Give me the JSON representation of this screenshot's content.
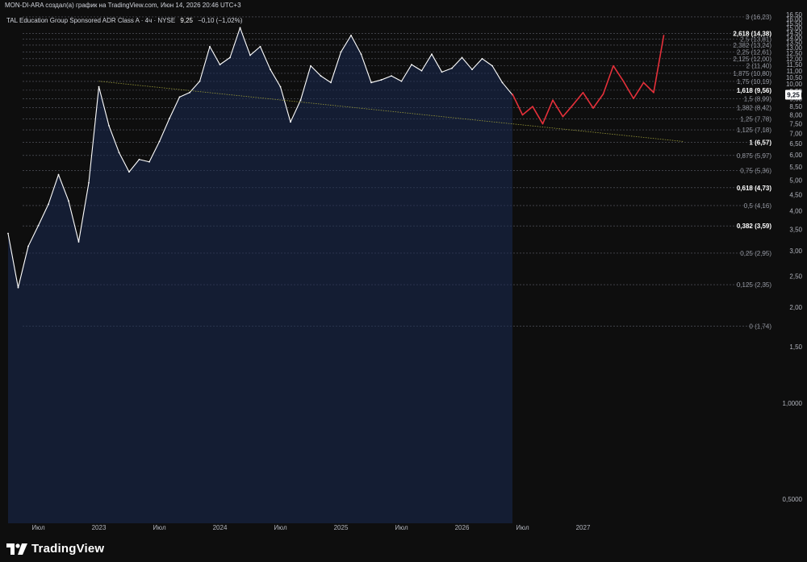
{
  "header": {
    "author_line": "MON-DI-ARA создал(а) график на TradingView.com, Июн 14, 2026 20:46 UTC+3"
  },
  "legend": {
    "symbol": "TAL Education Group Sponsored ADR Class A · 4ч · NYSE",
    "last": "9,25",
    "change": "−0,10 (−1,02%)"
  },
  "footer": {
    "brand": "TradingView"
  },
  "colors": {
    "background": "#0e0e0e",
    "price_line": "#ffffff",
    "area_fill": "#1a2a52",
    "projection": "#e5303a",
    "trendline": "#9a9a3a",
    "fib_lines": "#5d606b"
  },
  "chart_data": {
    "type": "area",
    "y_scale": "log",
    "ylim": [
      0.42,
      16.7
    ],
    "y_ticks": [
      "16,50",
      "16,00",
      "15,50",
      "15,00",
      "14,50",
      "14,00",
      "13,50",
      "13,00",
      "12,50",
      "12,00",
      "11,50",
      "11,00",
      "10,50",
      "10,00",
      "9,50",
      "9,00",
      "8,50",
      "8,00",
      "7,50",
      "7,00",
      "6,50",
      "6,00",
      "5,50",
      "5,00",
      "4,50",
      "4,00",
      "3,50",
      "3,00",
      "2,50",
      "2,00",
      "1,50",
      "1,0000",
      "0,5000"
    ],
    "x_ticks": [
      "Июл",
      "2023",
      "Июл",
      "2024",
      "Июл",
      "2025",
      "Июл",
      "2026",
      "Июл",
      "2027"
    ],
    "last_price_label": "9,25",
    "price_series": {
      "name": "",
      "points": [
        [
          "2022-04",
          3.4
        ],
        [
          "2022-05",
          2.3
        ],
        [
          "2022-06",
          3.1
        ],
        [
          "2022-07",
          3.6
        ],
        [
          "2022-08",
          4.2
        ],
        [
          "2022-09",
          5.2
        ],
        [
          "2022-10",
          4.3
        ],
        [
          "2022-11",
          3.2
        ],
        [
          "2022-12",
          4.9
        ],
        [
          "2023-01",
          9.8
        ],
        [
          "2023-02",
          7.4
        ],
        [
          "2023-03",
          6.1
        ],
        [
          "2023-04",
          5.3
        ],
        [
          "2023-05",
          5.8
        ],
        [
          "2023-06",
          5.7
        ],
        [
          "2023-07",
          6.6
        ],
        [
          "2023-08",
          7.8
        ],
        [
          "2023-09",
          9.1
        ],
        [
          "2023-10",
          9.4
        ],
        [
          "2023-11",
          10.2
        ],
        [
          "2023-12",
          13.1
        ],
        [
          "2024-01",
          11.5
        ],
        [
          "2024-02",
          12.1
        ],
        [
          "2024-03",
          15.0
        ],
        [
          "2024-04",
          12.3
        ],
        [
          "2024-05",
          13.1
        ],
        [
          "2024-06",
          11.1
        ],
        [
          "2024-07",
          9.8
        ],
        [
          "2024-08",
          7.6
        ],
        [
          "2024-09",
          8.9
        ],
        [
          "2024-10",
          11.4
        ],
        [
          "2024-11",
          10.6
        ],
        [
          "2024-12",
          10.1
        ],
        [
          "2025-01",
          12.6
        ],
        [
          "2025-02",
          14.2
        ],
        [
          "2025-03",
          12.4
        ],
        [
          "2025-04",
          10.1
        ],
        [
          "2025-05",
          10.3
        ],
        [
          "2025-06",
          10.6
        ],
        [
          "2025-07",
          10.2
        ],
        [
          "2025-08",
          11.5
        ],
        [
          "2025-09",
          11.0
        ],
        [
          "2025-10",
          12.4
        ],
        [
          "2025-11",
          10.9
        ],
        [
          "2025-12",
          11.2
        ],
        [
          "2026-01",
          12.1
        ],
        [
          "2026-02",
          11.1
        ],
        [
          "2026-03",
          12.0
        ],
        [
          "2026-04",
          11.4
        ],
        [
          "2026-05",
          10.1
        ],
        [
          "2026-06",
          9.25
        ]
      ]
    },
    "projection_series": {
      "name": "",
      "points": [
        [
          "2026-06",
          9.3
        ],
        [
          "2026-07",
          8.0
        ],
        [
          "2026-08",
          8.5
        ],
        [
          "2026-09",
          7.5
        ],
        [
          "2026-10",
          8.9
        ],
        [
          "2026-11",
          7.9
        ],
        [
          "2026-12",
          8.6
        ],
        [
          "2027-01",
          9.4
        ],
        [
          "2027-02",
          8.4
        ],
        [
          "2027-03",
          9.3
        ],
        [
          "2027-04",
          11.4
        ],
        [
          "2027-05",
          10.2
        ],
        [
          "2027-06",
          9.0
        ],
        [
          "2027-07",
          10.1
        ],
        [
          "2027-08",
          9.4
        ],
        [
          "2027-09",
          14.2
        ]
      ]
    },
    "trendline": {
      "from": [
        "2023-01",
        10.2
      ],
      "to": [
        "2027-11",
        6.6
      ]
    },
    "fib_levels": [
      {
        "label": "3 (16,23)",
        "value": 16.23,
        "key": false
      },
      {
        "label": "2,618 (14,38)",
        "value": 14.38,
        "key": true
      },
      {
        "label": "2,5 (13,81)",
        "value": 13.81,
        "key": false
      },
      {
        "label": "2,382 (13,24)",
        "value": 13.24,
        "key": false
      },
      {
        "label": "2,25 (12,61)",
        "value": 12.61,
        "key": false
      },
      {
        "label": "2,125 (12,00)",
        "value": 12.0,
        "key": false
      },
      {
        "label": "2 (11,40)",
        "value": 11.4,
        "key": false
      },
      {
        "label": "1,875 (10,80)",
        "value": 10.8,
        "key": false
      },
      {
        "label": "1,75 (10,19)",
        "value": 10.19,
        "key": false
      },
      {
        "label": "1,618 (9,56)",
        "value": 9.56,
        "key": true
      },
      {
        "label": "1,5 (8,99)",
        "value": 8.99,
        "key": false
      },
      {
        "label": "1,382 (8,42)",
        "value": 8.42,
        "key": false
      },
      {
        "label": "1,25 (7,78)",
        "value": 7.78,
        "key": false
      },
      {
        "label": "1,125 (7,18)",
        "value": 7.18,
        "key": false
      },
      {
        "label": "1 (6,57)",
        "value": 6.57,
        "key": true
      },
      {
        "label": "0,875 (5,97)",
        "value": 5.97,
        "key": false
      },
      {
        "label": "0,75 (5,36)",
        "value": 5.36,
        "key": false
      },
      {
        "label": "0,618 (4,73)",
        "value": 4.73,
        "key": true
      },
      {
        "label": "0,5 (4,16)",
        "value": 4.16,
        "key": false
      },
      {
        "label": "0,382 (3,59)",
        "value": 3.59,
        "key": true
      },
      {
        "label": "0,25 (2,95)",
        "value": 2.95,
        "key": false
      },
      {
        "label": "0,125 (2,35)",
        "value": 2.35,
        "key": false
      },
      {
        "label": "0 (1,74)",
        "value": 1.74,
        "key": false
      }
    ]
  }
}
